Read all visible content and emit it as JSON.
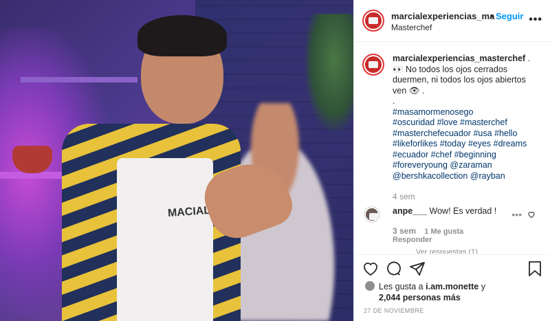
{
  "photo": {
    "apron_text": "MACIAL"
  },
  "header": {
    "username": "marcialexperiencias_ma",
    "separator": "•",
    "follow_label": "Seguir",
    "location": "Masterchef",
    "more_label": "•••"
  },
  "caption": {
    "username": "marcialexperiencias_masterchef",
    "after_user": " .",
    "line1": "👀 No todos los ojos cerrados duermen, ni todos los ojos abiertos ven 👁 .",
    "dot": ".",
    "hashtags": [
      "#masamormenosego",
      "#oscuridad",
      "#love",
      "#masterchef",
      "#masterchefecuador",
      "#usa",
      "#hello",
      "#likeforlikes",
      "#today",
      "#eyes",
      "#dreams",
      "#ecuador",
      "#chef",
      "#beginning",
      "#foreveryoung",
      "@zaraman",
      "@bershkacollection",
      "@rayban"
    ],
    "time": "4 sem"
  },
  "comment": {
    "username": "anpe___",
    "text": "Wow! Es verdad !",
    "time": "3 sem",
    "likes": "1 Me gusta",
    "reply": "Responder",
    "more": "•••",
    "view_replies": "Ver respuestas (1)"
  },
  "likes": {
    "prefix": "Les gusta a",
    "user": "i.am.monette",
    "conj": "y",
    "count": "2,044 personas más"
  },
  "date": "27 DE NOVIEMBRE"
}
